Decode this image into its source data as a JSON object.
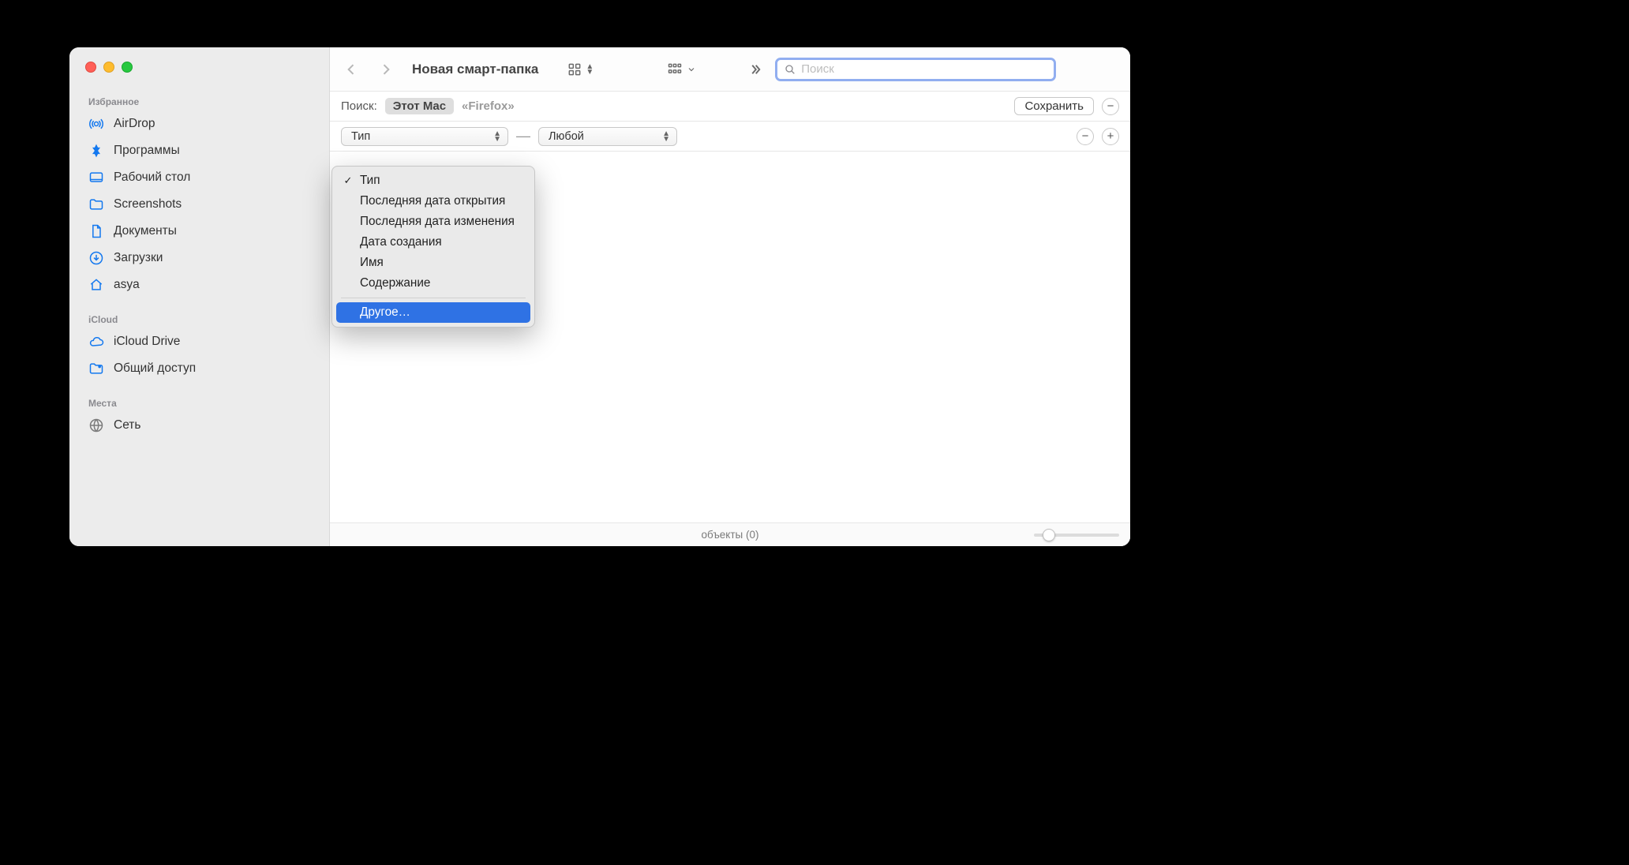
{
  "window": {
    "title": "Новая смарт-папка"
  },
  "sidebar": {
    "sections": {
      "favorites": {
        "label": "Избранное"
      },
      "icloud": {
        "label": "iCloud"
      },
      "places": {
        "label": "Места"
      }
    },
    "items": {
      "airdrop": {
        "label": "AirDrop"
      },
      "apps": {
        "label": "Программы"
      },
      "desktop": {
        "label": "Рабочий стол"
      },
      "screenshots": {
        "label": "Screenshots"
      },
      "documents": {
        "label": "Документы"
      },
      "downloads": {
        "label": "Загрузки"
      },
      "home": {
        "label": "asya"
      },
      "iclouddrive": {
        "label": "iCloud Drive"
      },
      "shared": {
        "label": "Общий доступ"
      },
      "network": {
        "label": "Сеть"
      }
    }
  },
  "toolbar": {
    "search_placeholder": "Поиск"
  },
  "scope": {
    "label": "Поиск:",
    "this_mac": "Этот Mac",
    "firefox": "«Firefox»",
    "save": "Сохранить"
  },
  "criteria": {
    "kind_selected": "Тип",
    "value_selected": "Любой"
  },
  "menu": {
    "items": {
      "type": "Тип",
      "last_open": "Последняя дата открытия",
      "last_mod": "Последняя дата изменения",
      "created": "Дата создания",
      "name": "Имя",
      "contents": "Содержание",
      "other": "Другое…"
    }
  },
  "status": {
    "text": "объекты (0)"
  }
}
